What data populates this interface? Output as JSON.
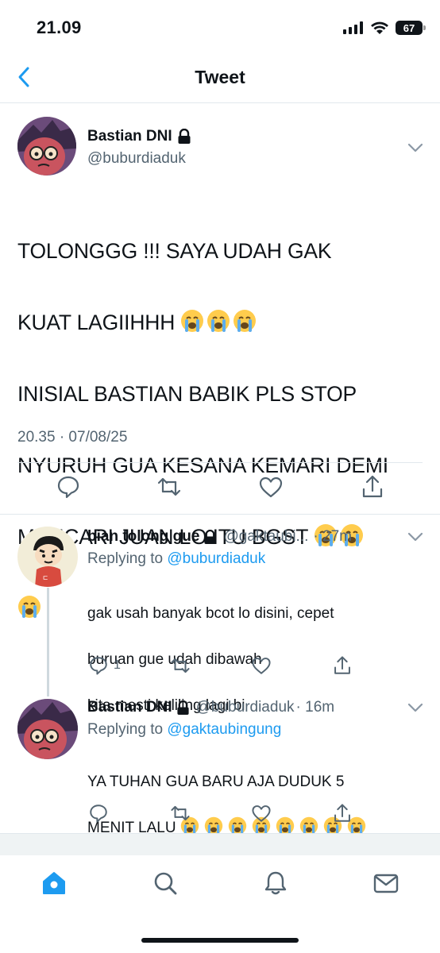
{
  "status_bar": {
    "time": "21.09",
    "battery": "67"
  },
  "nav": {
    "title": "Tweet",
    "back_icon": "chevron-left-icon"
  },
  "main_tweet": {
    "name": "Bastian DNI",
    "handle": "@buburdiaduk",
    "text_line1": "TOLONGGG !!! SAYA UDAH GAK",
    "text_line2": "KUAT LAGIIHHH",
    "text_line3": "INISIAL BASTIAN BABIK PLS STOP",
    "text_line4": "NYURUH GUA KESANA KEMARI DEMI",
    "text_line5": "MENCARI JUAN LO ITU BGST",
    "timestamp": "20.35 · 07/08/25"
  },
  "replies": [
    {
      "name": "bian tolong gue",
      "handle": "@gaktaubi...",
      "time": "· 27m",
      "replying_prefix": "Replying to",
      "replying_to": "@buburdiaduk",
      "text_line1": "gak usah banyak bcot lo disini, cepet",
      "text_line2": "buruan gue udah dibawah",
      "text_line3": "kita mesti keliling lagi bi",
      "reply_count": "1"
    },
    {
      "name": "Bastian DNI",
      "handle": "@buburdiaduk",
      "time": "· 16m",
      "replying_prefix": "Replying to",
      "replying_to": "@gaktaubingung",
      "text_line1": "YA TUHAN GUA BARU AJA DUDUK 5",
      "text_line2": "MENIT LALU"
    }
  ],
  "tabs": [
    "home-icon",
    "search-icon",
    "bell-icon",
    "mail-icon"
  ],
  "colors": {
    "accent": "#1d9bf0",
    "text": "#0f1419",
    "muted": "#536471",
    "divider": "#e1e8ed"
  }
}
